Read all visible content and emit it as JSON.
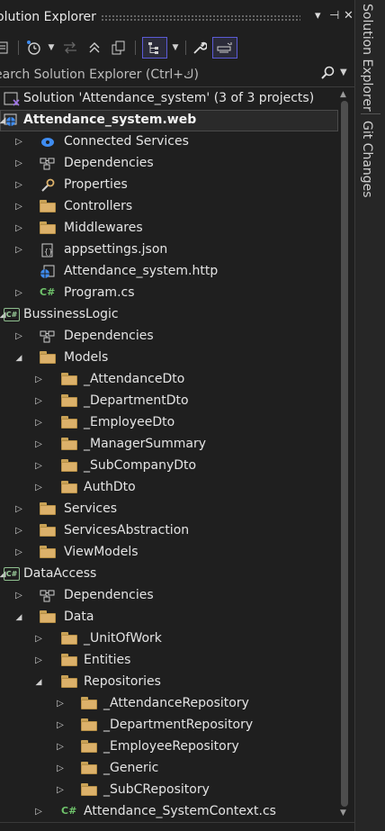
{
  "window": {
    "title": "olution Explorer",
    "pin_glyph": "▾",
    "autohide_glyph": "⊣",
    "close_glyph": "✕"
  },
  "search": {
    "placeholder": "earch Solution Explorer (Ctrl+ك)"
  },
  "side_tabs": [
    "Solution Explorer",
    "Git Changes"
  ],
  "tree": [
    {
      "label": "Solution 'Attendance_system' (3 of 3 projects)",
      "icon": "solution-icon",
      "level": 0,
      "expander": "none"
    },
    {
      "label": "Attendance_system.web",
      "icon": "web-project-icon",
      "level": 0,
      "expander": "open",
      "bold": true,
      "selected": true
    },
    {
      "label": "Connected Services",
      "icon": "connected-services-icon",
      "level": 1,
      "expander": "closed"
    },
    {
      "label": "Dependencies",
      "icon": "dependencies-icon",
      "level": 1,
      "expander": "closed"
    },
    {
      "label": "Properties",
      "icon": "properties-icon",
      "level": 1,
      "expander": "closed"
    },
    {
      "label": "Controllers",
      "icon": "folder-icon",
      "level": 1,
      "expander": "closed"
    },
    {
      "label": "Middlewares",
      "icon": "folder-icon",
      "level": 1,
      "expander": "closed"
    },
    {
      "label": "appsettings.json",
      "icon": "json-file-icon",
      "level": 1,
      "expander": "closed"
    },
    {
      "label": "Attendance_system.http",
      "icon": "http-file-icon",
      "level": 1,
      "expander": "none"
    },
    {
      "label": "Program.cs",
      "icon": "csharp-file-icon",
      "level": 1,
      "expander": "closed"
    },
    {
      "label": "BussinessLogic",
      "icon": "csharp-project-icon",
      "level": 0,
      "expander": "open"
    },
    {
      "label": "Dependencies",
      "icon": "dependencies-icon",
      "level": 1,
      "expander": "closed"
    },
    {
      "label": "Models",
      "icon": "folder-icon",
      "level": 1,
      "expander": "open"
    },
    {
      "label": "_AttendanceDto",
      "icon": "folder-icon",
      "level": 2,
      "expander": "closed"
    },
    {
      "label": "_DepartmentDto",
      "icon": "folder-icon",
      "level": 2,
      "expander": "closed"
    },
    {
      "label": "_EmployeeDto",
      "icon": "folder-icon",
      "level": 2,
      "expander": "closed"
    },
    {
      "label": "_ManagerSummary",
      "icon": "folder-icon",
      "level": 2,
      "expander": "closed"
    },
    {
      "label": "_SubCompanyDto",
      "icon": "folder-icon",
      "level": 2,
      "expander": "closed"
    },
    {
      "label": "AuthDto",
      "icon": "folder-icon",
      "level": 2,
      "expander": "closed"
    },
    {
      "label": "Services",
      "icon": "folder-icon",
      "level": 1,
      "expander": "closed"
    },
    {
      "label": "ServicesAbstraction",
      "icon": "folder-icon",
      "level": 1,
      "expander": "closed"
    },
    {
      "label": "ViewModels",
      "icon": "folder-icon",
      "level": 1,
      "expander": "closed"
    },
    {
      "label": "DataAccess",
      "icon": "csharp-project-icon",
      "level": 0,
      "expander": "open"
    },
    {
      "label": "Dependencies",
      "icon": "dependencies-icon",
      "level": 1,
      "expander": "closed"
    },
    {
      "label": "Data",
      "icon": "folder-icon",
      "level": 1,
      "expander": "open"
    },
    {
      "label": "_UnitOfWork",
      "icon": "folder-icon",
      "level": 2,
      "expander": "closed"
    },
    {
      "label": "Entities",
      "icon": "folder-icon",
      "level": 2,
      "expander": "closed"
    },
    {
      "label": "Repositories",
      "icon": "folder-icon",
      "level": 2,
      "expander": "open"
    },
    {
      "label": "_AttendanceRepository",
      "icon": "folder-icon",
      "level": 3,
      "expander": "closed"
    },
    {
      "label": "_DepartmentRepository",
      "icon": "folder-icon",
      "level": 3,
      "expander": "closed"
    },
    {
      "label": "_EmployeeRepository",
      "icon": "folder-icon",
      "level": 3,
      "expander": "closed"
    },
    {
      "label": "_Generic",
      "icon": "folder-icon",
      "level": 3,
      "expander": "closed"
    },
    {
      "label": "_SubCRepository",
      "icon": "folder-icon",
      "level": 3,
      "expander": "closed"
    },
    {
      "label": "Attendance_SystemContext.cs",
      "icon": "csharp-file-icon",
      "level": 2,
      "expander": "closed"
    }
  ],
  "colors": {
    "background": "#1f1f1f",
    "accent": "#5b5bd6",
    "folder": "#dcb16a",
    "csharp": "#6fc36b"
  }
}
